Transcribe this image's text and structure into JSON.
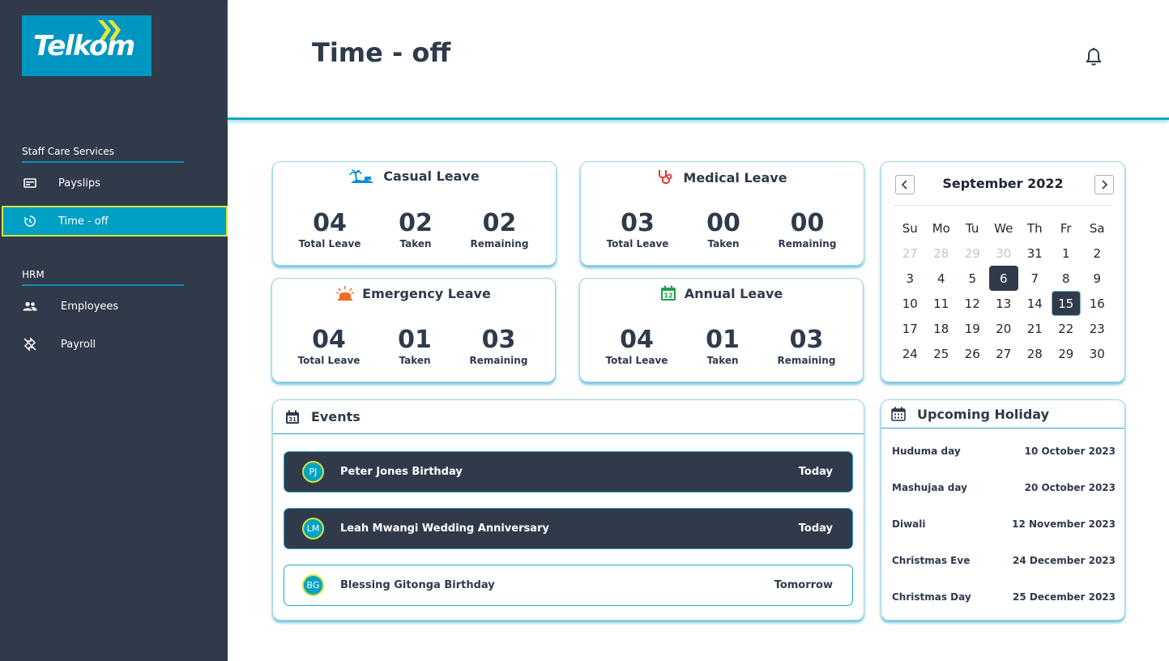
{
  "brand": {
    "logo_text": "Telkom"
  },
  "sidebar": {
    "sections": [
      {
        "title": "Staff Care Services"
      },
      {
        "title": "HRM"
      }
    ],
    "items": [
      {
        "label": "Payslips",
        "icon": "payslip-icon"
      },
      {
        "label": "Time - off",
        "icon": "clock-icon",
        "active": true
      },
      {
        "label": "Employees",
        "icon": "people-icon"
      },
      {
        "label": "Payroll",
        "icon": "payroll-icon"
      }
    ]
  },
  "header": {
    "title": "Time - off",
    "icon": "bell-icon"
  },
  "leave_cards": [
    {
      "title": "Casual Leave",
      "icon": "beach-icon",
      "total": "04",
      "taken": "02",
      "remaining": "02"
    },
    {
      "title": "Medical Leave",
      "icon": "stethoscope-icon",
      "total": "03",
      "taken": "00",
      "remaining": "00"
    },
    {
      "title": "Emergency Leave",
      "icon": "siren-icon",
      "total": "04",
      "taken": "01",
      "remaining": "03"
    },
    {
      "title": "Annual Leave",
      "icon": "calendar-12-icon",
      "total": "04",
      "taken": "01",
      "remaining": "03"
    }
  ],
  "stat_labels": {
    "total": "Total Leave",
    "taken": "Taken",
    "remaining": "Remaining"
  },
  "calendar": {
    "month": "September 2022",
    "weekdays": [
      "Su",
      "Mo",
      "Tu",
      "We",
      "Th",
      "Fr",
      "Sa"
    ],
    "days": [
      [
        "27",
        "28",
        "29",
        "30",
        "31",
        "1",
        "2"
      ],
      [
        "3",
        "4",
        "5",
        "6",
        "7",
        "8",
        "9"
      ],
      [
        "10",
        "11",
        "12",
        "13",
        "14",
        "15",
        "16"
      ],
      [
        "17",
        "18",
        "19",
        "20",
        "21",
        "22",
        "23"
      ],
      [
        "24",
        "25",
        "26",
        "27",
        "28",
        "29",
        "30"
      ]
    ],
    "muted_days": [
      "27",
      "28",
      "29",
      "30"
    ],
    "selected": [
      "6",
      "15"
    ]
  },
  "events": {
    "title": "Events",
    "items": [
      {
        "initials": "PJ",
        "name": "Peter Jones Birthday",
        "when": "Today",
        "style": "dark"
      },
      {
        "initials": "LM",
        "name": "Leah Mwangi Wedding Anniversary",
        "when": "Today",
        "style": "dark"
      },
      {
        "initials": "BG",
        "name": "Blessing Gitonga Birthday",
        "when": "Tomorrow",
        "style": "light"
      }
    ]
  },
  "holidays": {
    "title": "Upcoming Holiday",
    "items": [
      {
        "name": "Huduma day",
        "date": "10 October 2023"
      },
      {
        "name": "Mashujaa day",
        "date": "20 October 2023"
      },
      {
        "name": "Diwali",
        "date": "12 November 2023"
      },
      {
        "name": "Christmas Eve",
        "date": "24 December 2023"
      },
      {
        "name": "Christmas Day",
        "date": "25 December 2023"
      }
    ]
  },
  "colors": {
    "sidebar": "#313a4b",
    "accent": "#009fc4",
    "active_border": "#d6e43a"
  }
}
